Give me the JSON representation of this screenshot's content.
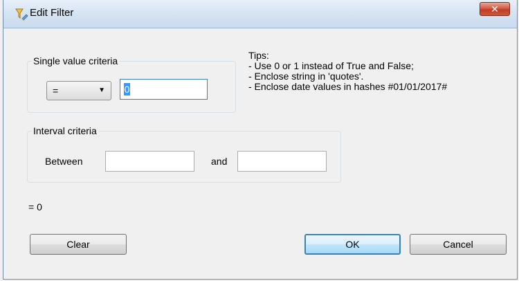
{
  "window": {
    "title": "Edit Filter",
    "close_label": "✕"
  },
  "single": {
    "legend": "Single value criteria",
    "operator": "=",
    "value": "0"
  },
  "tips": {
    "heading": "Tips:",
    "lines": [
      "- Use 0 or 1 instead of True and False;",
      "- Enclose string in 'quotes'.",
      "- Enclose date values in hashes #01/01/2017#"
    ]
  },
  "interval": {
    "legend": "Interval criteria",
    "between_label": "Between",
    "and_label": "and",
    "from_value": "",
    "to_value": ""
  },
  "expression": "= 0",
  "buttons": {
    "clear": "Clear",
    "ok": "OK",
    "cancel": "Cancel"
  }
}
